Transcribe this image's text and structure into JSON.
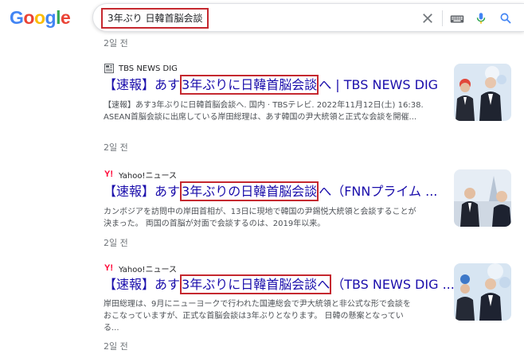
{
  "header": {
    "logo_letters": [
      "G",
      "o",
      "o",
      "g",
      "l",
      "e"
    ],
    "logo_colors": [
      "#4285F4",
      "#EA4335",
      "#FBBC05",
      "#4285F4",
      "#34A853",
      "#EA4335"
    ],
    "query": "3年ぶり 日韓首脳会談",
    "highlight_color": "#c5282f"
  },
  "previous_result_age": "2일 전",
  "results": [
    {
      "source": "TBS NEWS DIG",
      "title_prefix": "【速報】あす",
      "title_highlight": "3年ぶりに日韓首脳会談",
      "title_suffix": "へ | TBS NEWS DIG",
      "snippet_line1": "【速報】あす3年ぶりに日韓首脳会談へ. 国内 · TBSテレビ. 2022年11月12日(土) 16:38.",
      "snippet_line2": "ASEAN首脳会談に出席している岸田総理は、あす韓国の尹大統領と正式な会談を開催...",
      "age": "2일 전"
    },
    {
      "source": "Yahoo!ニュース",
      "title_prefix": "【速報】あす",
      "title_highlight": "3年ぶりの日韓首脳会談",
      "title_suffix": "へ（FNNプライム ...",
      "snippet_line1": "カンボジアを訪問中の岸田首相が、13日に現地で韓国の尹錫悦大統領と会談することが",
      "snippet_line2": "決まった。 両国の首脳が対面で会談するのは、2019年以来。",
      "age": "2일 전"
    },
    {
      "source": "Yahoo!ニュース",
      "title_prefix": "【速報】あす",
      "title_highlight": "3年ぶりに日韓首脳会談へ",
      "title_suffix": "（TBS NEWS DIG ...",
      "snippet_line1": "岸田総理は、9月にニューヨークで行われた国連総会で尹大統領と非公式な形で会談を",
      "snippet_line2": "おこなっていますが、正式な首脳会談は3年ぶりとなります。 日韓の懸案となってい",
      "snippet_line3": "る...",
      "age": "2일 전"
    }
  ],
  "icons": {
    "clear": "close-icon",
    "keyboard": "keyboard-icon",
    "voice": "mic-icon",
    "search": "search-icon",
    "yahoo_favicon_glyph": "Y!"
  }
}
